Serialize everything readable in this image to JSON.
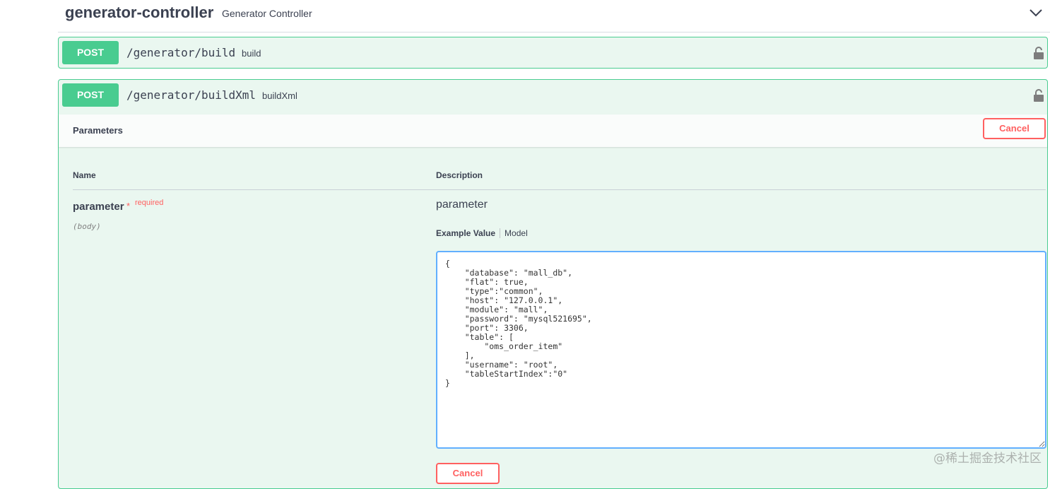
{
  "tag": {
    "title": "generator-controller",
    "description": "Generator Controller"
  },
  "operations": [
    {
      "method": "POST",
      "path": "/generator/build",
      "summary": "build"
    },
    {
      "method": "POST",
      "path": "/generator/buildXml",
      "summary": "buildXml",
      "parameters_title": "Parameters",
      "cancel_label": "Cancel",
      "columns": {
        "name": "Name",
        "description": "Description"
      },
      "parameter": {
        "name": "parameter",
        "required_star": "*",
        "required_label": "required",
        "in": "(body)",
        "description": "parameter",
        "tabs": {
          "example": "Example Value",
          "model": "Model"
        },
        "body_value": "{\n    \"database\": \"mall_db\",\n    \"flat\": true,\n    \"type\":\"common\",\n    \"host\": \"127.0.0.1\",\n    \"module\": \"mall\",\n    \"password\": \"mysql521695\",\n    \"port\": 3306,\n    \"table\": [\n        \"oms_order_item\"\n    ],\n    \"username\": \"root\",\n    \"tableStartIndex\":\"0\"\n}"
      },
      "bottom_cancel_label": "Cancel"
    }
  ],
  "watermark": "@稀土掘金技术社区",
  "colors": {
    "post_green": "#49cc90",
    "op_bg": "#eaf7f0",
    "cancel_red": "#ff6060",
    "editor_border": "#61affe"
  },
  "icons": {
    "chevron": "chevron-down-icon",
    "lock": "lock-icon",
    "resize": "resize-grip-icon"
  }
}
